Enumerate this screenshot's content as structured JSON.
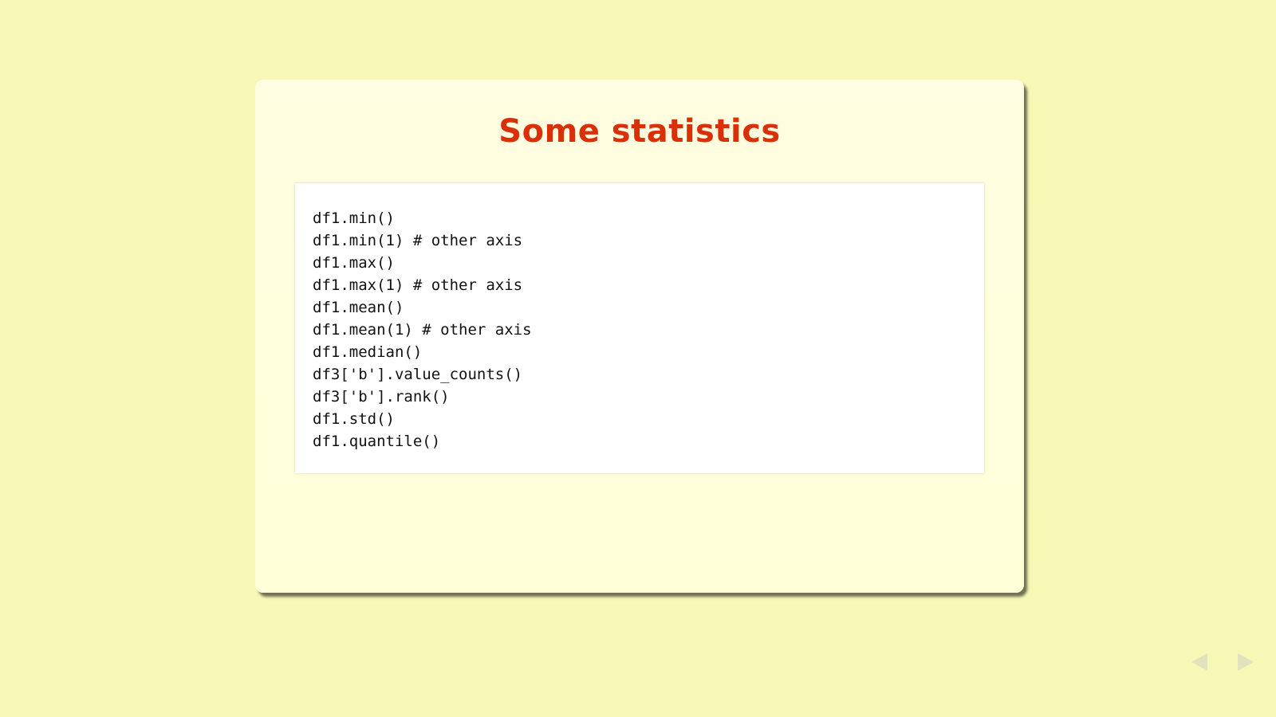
{
  "slide": {
    "title": "Some statistics",
    "code_lines": [
      "df1.min()",
      "df1.min(1) # other axis",
      "df1.max()",
      "df1.max(1) # other axis",
      "df1.mean()",
      "df1.mean(1) # other axis",
      "df1.median()",
      "df3['b'].value_counts()",
      "df3['b'].rank()",
      "df1.std()",
      "df1.quantile()"
    ]
  },
  "navigation": {
    "prev_icon": "left-arrow-icon",
    "next_icon": "right-arrow-icon"
  },
  "colors": {
    "background": "#f7f7b6",
    "slide_background": "#ffffdd",
    "title": "#d9300a",
    "code_background": "#ffffff"
  }
}
